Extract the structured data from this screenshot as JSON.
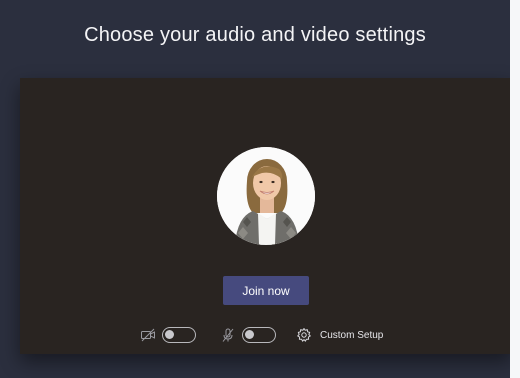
{
  "page": {
    "title": "Choose your audio and video settings"
  },
  "preview": {
    "avatar_icon": "user-photo",
    "join_button_label": "Join now"
  },
  "controls": {
    "camera": {
      "icon": "camera-off-icon",
      "toggle_on": false
    },
    "microphone": {
      "icon": "mic-off-icon",
      "toggle_on": false
    },
    "custom_setup": {
      "icon": "gear-icon",
      "label": "Custom Setup"
    }
  },
  "colors": {
    "background": "#2b2f3e",
    "preview": "#292421",
    "join_button": "#464a7e"
  }
}
